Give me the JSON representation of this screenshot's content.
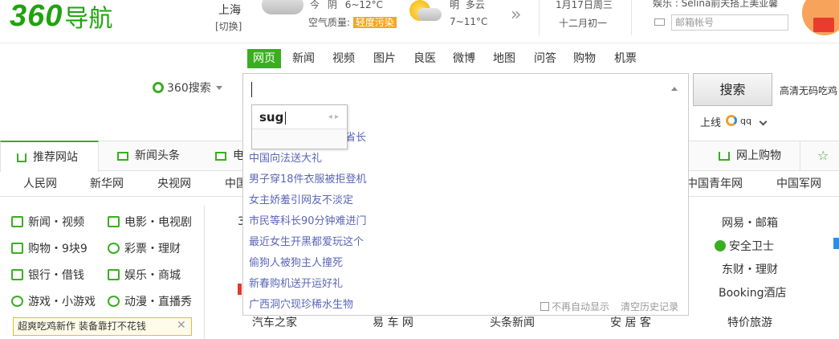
{
  "header": {
    "logo_num": "360",
    "logo_text": "导航",
    "city": "上海",
    "switch_city": "[切换]",
    "today_label": "今",
    "today_weather": "阴",
    "today_temp": "6~12°C",
    "air_quality_label": "空气质量:",
    "air_quality_value": "轻度污染",
    "tomorrow_label": "明",
    "tomorrow_weather": "多云",
    "tomorrow_temp": "7~11°C",
    "more_weather": "»",
    "date": "1月17日周三",
    "lunar_date": "十二月初一",
    "ent_news": "娱乐 : Selina前夫搭上美亚馨",
    "mail_placeholder": "邮箱帐号"
  },
  "search": {
    "engine": "360搜索",
    "tabs": [
      "网页",
      "新闻",
      "视频",
      "图片",
      "良医",
      "微博",
      "地图",
      "问答",
      "购物",
      "机票"
    ],
    "active_tab": "网页",
    "button": "搜索",
    "hot_right": "高清无码吃鸡",
    "ime_word": "sug",
    "ime_nav": "◂ ▸",
    "suggestions": [
      "",
      "省长",
      "中国向法送大礼",
      "男子穿18件衣服被拒登机",
      "女主娇羞引网友不淡定",
      "市民等科长90分钟难进门",
      "最近女生开黑都爱玩这个",
      "偷狗人被狗主人撞死",
      "新春购机送开运好礼",
      "广西洞穴现珍稀水生物"
    ],
    "no_auto_show": "不再自动显示",
    "clear_history": "清空历史记录",
    "online_label": "上线",
    "qq_label": "qq"
  },
  "nav_tabs": {
    "recommend": "推荐网站",
    "news_headlines": "新闻头条",
    "partial": "电",
    "shopping": "网上购物"
  },
  "sites": [
    "人民网",
    "新华网",
    "央视网",
    "中国",
    "中国青年网",
    "中国军网"
  ],
  "categories": [
    [
      "新闻・视频",
      "电影・电视剧"
    ],
    [
      "购物・9块9",
      "彩票・理财"
    ],
    [
      "银行・借钱",
      "娱乐・商城"
    ],
    [
      "游戏・小游戏",
      "动漫・直播秀"
    ]
  ],
  "promo": "超爽吃鸡新作 装备靠打不花钱",
  "promo_close": "✕",
  "bottom_sites": [
    "汽车之家",
    "易 车 网",
    "头条新闻",
    "安 居 客",
    "特价旅游"
  ],
  "right_sites": [
    "网易・邮箱",
    "安全卫士",
    "东财・理财",
    "Booking酒店"
  ],
  "partial_left": "3"
}
